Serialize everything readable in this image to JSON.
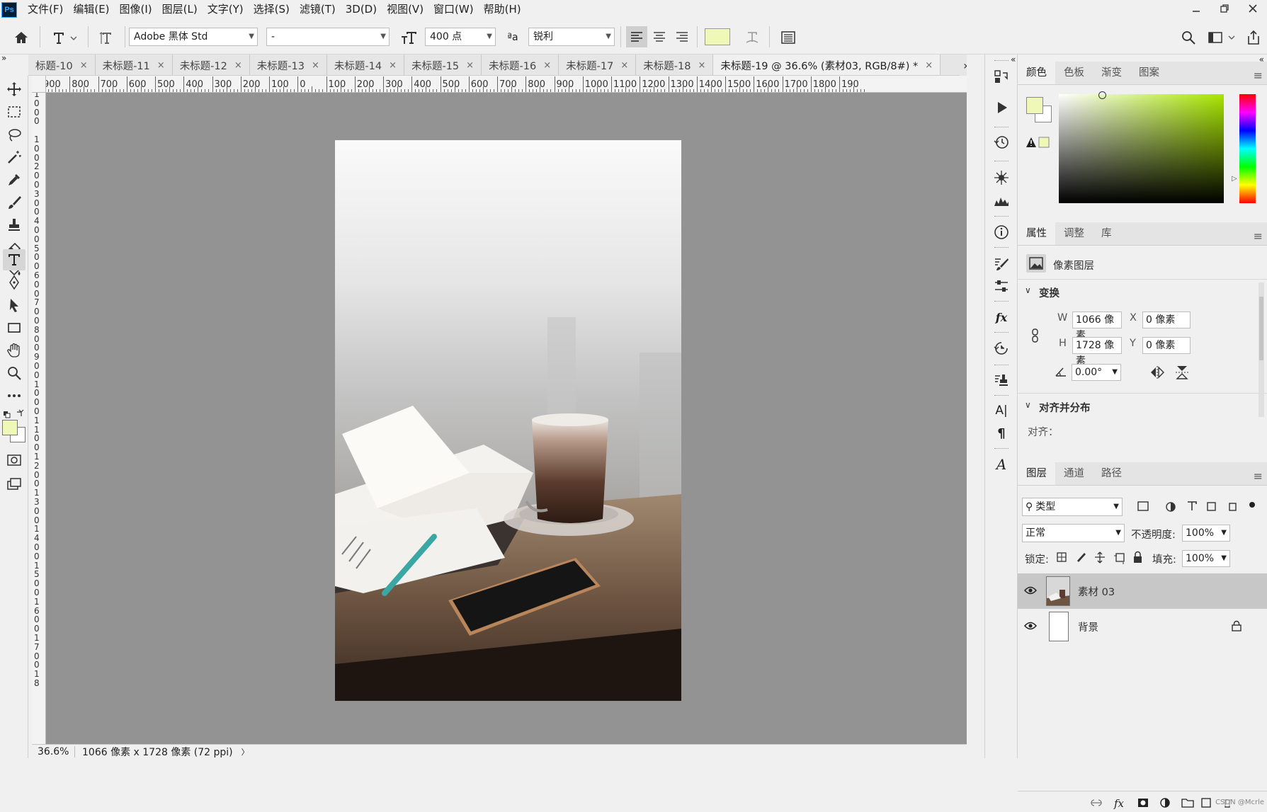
{
  "app": {
    "logo": "Ps"
  },
  "menu": [
    "文件(F)",
    "编辑(E)",
    "图像(I)",
    "图层(L)",
    "文字(Y)",
    "选择(S)",
    "滤镜(T)",
    "3D(D)",
    "视图(V)",
    "窗口(W)",
    "帮助(H)"
  ],
  "options": {
    "font_family": "Adobe 黑体 Std",
    "font_style": "-",
    "font_size": "400 点",
    "antialias_symbol": "ªa",
    "antialias": "锐利",
    "text_color": "#f0f8b8"
  },
  "tabs": [
    {
      "label": "标题-10"
    },
    {
      "label": "未标题-11"
    },
    {
      "label": "未标题-12"
    },
    {
      "label": "未标题-13"
    },
    {
      "label": "未标题-14"
    },
    {
      "label": "未标题-15"
    },
    {
      "label": "未标题-16"
    },
    {
      "label": "未标题-17"
    },
    {
      "label": "未标题-18"
    },
    {
      "label": "未标题-19 @ 36.6% (素材03, RGB/8#) *",
      "active": true
    }
  ],
  "tab_close": "×",
  "tab_overflow": "»",
  "ruler_top": [
    "900",
    "800",
    "700",
    "600",
    "500",
    "400",
    "300",
    "200",
    "100",
    "0",
    "100",
    "200",
    "300",
    "400",
    "500",
    "600",
    "700",
    "800",
    "900",
    "1000",
    "1100",
    "1200",
    "1300",
    "1400",
    "1500",
    "1600",
    "1700",
    "1800",
    "190"
  ],
  "ruler_left": [
    "1",
    "0",
    "0",
    "0",
    "",
    "1",
    "0",
    "0",
    "2",
    "0",
    "0",
    "3",
    "0",
    "0",
    "4",
    "0",
    "0",
    "5",
    "0",
    "0",
    "6",
    "0",
    "0",
    "7",
    "0",
    "0",
    "8",
    "0",
    "0",
    "9",
    "0",
    "0",
    "1",
    "0",
    "0",
    "0",
    "1",
    "1",
    "0",
    "0",
    "1",
    "2",
    "0",
    "0",
    "1",
    "3",
    "0",
    "0",
    "1",
    "4",
    "0",
    "0",
    "1",
    "5",
    "0",
    "0",
    "1",
    "6",
    "0",
    "0",
    "1",
    "7",
    "0",
    "0",
    "1",
    "8"
  ],
  "status": {
    "zoom": "36.6%",
    "info": "1066 像素 x 1728 像素 (72 ppi)",
    "arrow": "〉"
  },
  "colors": {
    "foreground": "#f0f8b8",
    "background": "#ffffff"
  },
  "color_panel": {
    "tabs": [
      "颜色",
      "色板",
      "渐变",
      "图案"
    ],
    "hue": "#a8e600"
  },
  "properties": {
    "tabs": [
      "属性",
      "调整",
      "库"
    ],
    "layer_type": "像素图层",
    "transform_title": "变换",
    "w_label": "W",
    "w": "1066 像素",
    "x_label": "X",
    "x": "0 像素",
    "h_label": "H",
    "h": "1728 像素",
    "y_label": "Y",
    "y": "0 像素",
    "angle": "0.00°",
    "align_title": "对齐并分布",
    "align_label": "对齐："
  },
  "layers": {
    "tabs": [
      "图层",
      "通道",
      "路径"
    ],
    "filter": "类型",
    "blend": "正常",
    "opacity_label": "不透明度:",
    "opacity": "100%",
    "lock_label": "锁定:",
    "fill_label": "填充:",
    "fill": "100%",
    "items": [
      {
        "name": "素材 03",
        "selected": true
      },
      {
        "name": "背景",
        "locked": true
      }
    ],
    "watermark": "CSDN @Mcrle"
  }
}
